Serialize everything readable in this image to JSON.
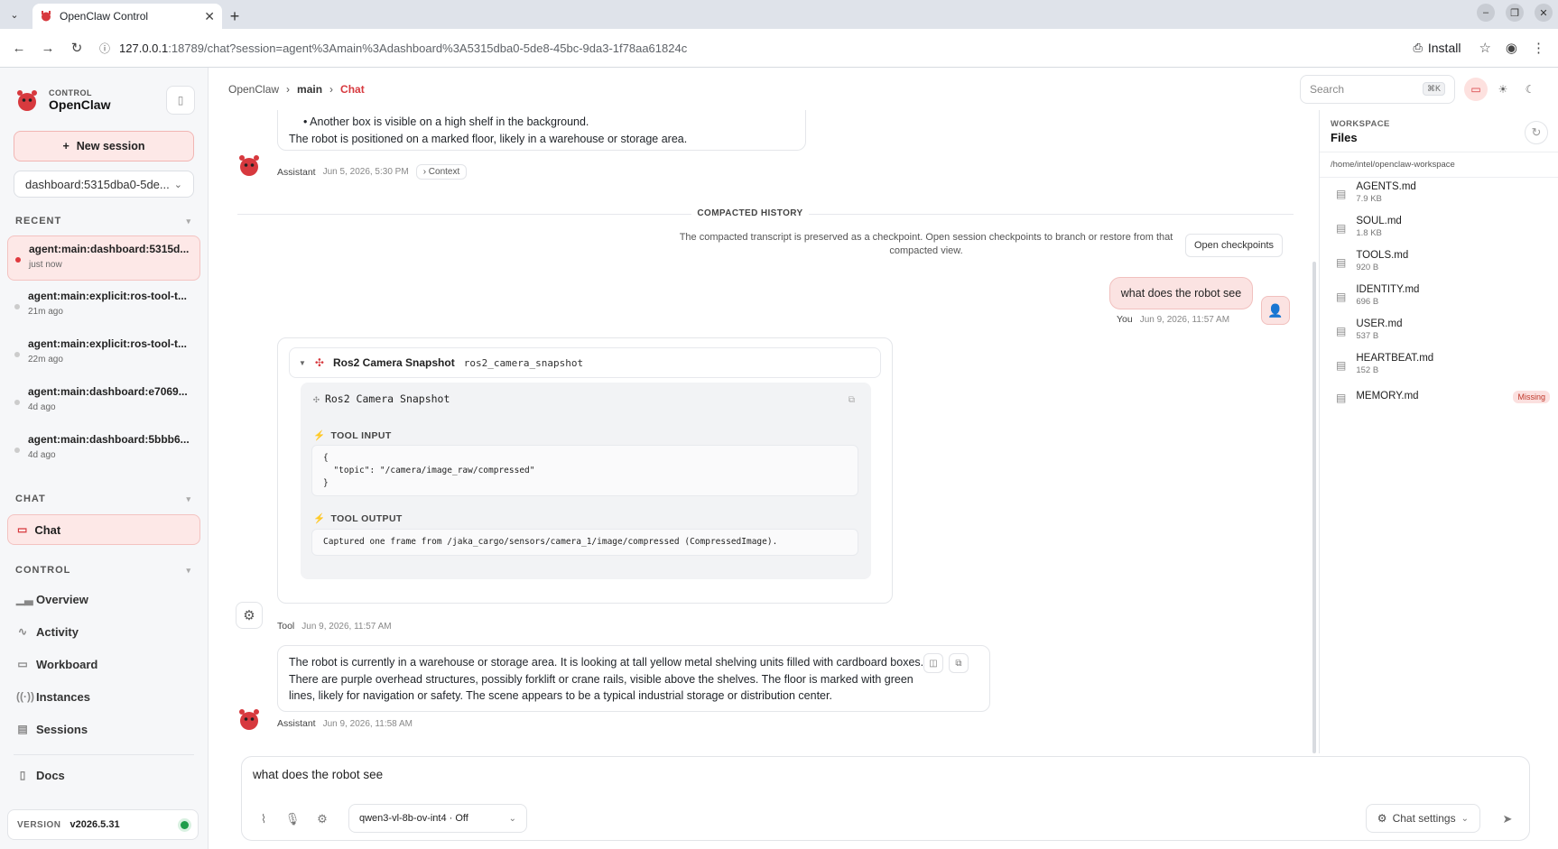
{
  "browser": {
    "tab_title": "OpenClaw Control",
    "url_host": "127.0.0.1",
    "url_rest": ":18789/chat?session=agent%3Amain%3Adashboard%3A5315dba0-5de8-45bc-9da3-1f78aa61824c",
    "install_label": "Install"
  },
  "sidebar": {
    "brand_small": "CONTROL",
    "brand_name": "OpenClaw",
    "new_session": "New session",
    "session_select": "dashboard:5315dba0-5de...",
    "recent_label": "RECENT",
    "recent": [
      {
        "title": "agent:main:dashboard:5315d...",
        "time": "just now"
      },
      {
        "title": "agent:main:explicit:ros-tool-t...",
        "time": "21m ago"
      },
      {
        "title": "agent:main:explicit:ros-tool-t...",
        "time": "22m ago"
      },
      {
        "title": "agent:main:dashboard:e7069...",
        "time": "4d ago"
      },
      {
        "title": "agent:main:dashboard:5bbb6...",
        "time": "4d ago"
      }
    ],
    "chat_label": "CHAT",
    "chat_item": "Chat",
    "control_label": "CONTROL",
    "control_items": [
      "Overview",
      "Activity",
      "Workboard",
      "Instances",
      "Sessions"
    ],
    "docs": "Docs",
    "version_label": "VERSION",
    "version_value": "v2026.5.31"
  },
  "topbar": {
    "crumb_root": "OpenClaw",
    "crumb_mid": "main",
    "crumb_current": "Chat",
    "search_placeholder": "Search",
    "search_kbd": "⌘K"
  },
  "messages": {
    "first_bullet": "Another box is visible on a high shelf in the background.",
    "first_line": "The robot is positioned on a marked floor, likely in a warehouse or storage area.",
    "first_who": "Assistant",
    "first_time": "Jun 5, 2026, 5:30 PM",
    "context_chip": "Context",
    "compacted_title": "COMPACTED HISTORY",
    "compacted_text": "The compacted transcript is preserved as a checkpoint. Open session checkpoints to branch or restore from that compacted view.",
    "open_checkpoints": "Open checkpoints",
    "user_text": "what does the robot see",
    "user_who": "You",
    "user_time": "Jun 9, 2026, 11:57 AM",
    "tool_name": "Ros2 Camera Snapshot",
    "tool_id": "ros2_camera_snapshot",
    "tool_body_title": "Ros2 Camera Snapshot",
    "tool_input_label": "TOOL INPUT",
    "tool_input_code": "{\n  \"topic\": \"/camera/image_raw/compressed\"\n}",
    "tool_output_label": "TOOL OUTPUT",
    "tool_output_code": "Captured one frame from /jaka_cargo/sensors/camera_1/image/compressed (CompressedImage).",
    "tool_who": "Tool",
    "tool_time": "Jun 9, 2026, 11:57 AM",
    "answer_text": "The robot is currently in a warehouse or storage area. It is looking at tall yellow metal shelving units filled with cardboard boxes. There are purple overhead structures, possibly forklift or crane rails, visible above the shelves. The floor is marked with green lines, likely for navigation or safety. The scene appears to be a typical industrial storage or distribution center.",
    "answer_who": "Assistant",
    "answer_time": "Jun 9, 2026, 11:58 AM"
  },
  "composer": {
    "input_value": "what does the robot see",
    "model": "qwen3-vl-8b-ov-int4 · Off",
    "chat_settings": "Chat settings"
  },
  "workspace": {
    "small": "WORKSPACE",
    "title": "Files",
    "path": "/home/intel/openclaw-workspace",
    "files": [
      {
        "name": "AGENTS.md",
        "size": "7.9 KB"
      },
      {
        "name": "SOUL.md",
        "size": "1.8 KB"
      },
      {
        "name": "TOOLS.md",
        "size": "920 B"
      },
      {
        "name": "IDENTITY.md",
        "size": "696 B"
      },
      {
        "name": "USER.md",
        "size": "537 B"
      },
      {
        "name": "HEARTBEAT.md",
        "size": "152 B"
      },
      {
        "name": "MEMORY.md",
        "size": "",
        "badge": "Missing"
      }
    ]
  },
  "colors": {
    "accent": "#d7393e",
    "accent_bg": "#fde8e7",
    "status_ok": "#1f9d4b"
  }
}
